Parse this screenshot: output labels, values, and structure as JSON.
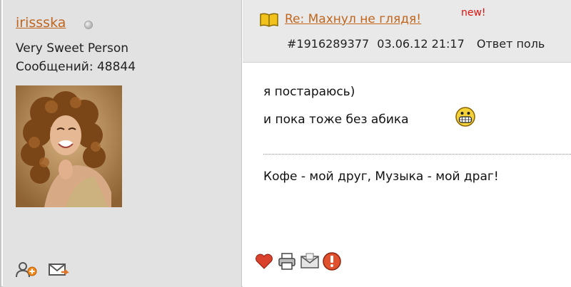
{
  "user": {
    "username": "irissska",
    "title": "Very Sweet Person",
    "posts": "Сообщений: 48844"
  },
  "message": {
    "subject": "Re: Махнул не глядя!",
    "badge": "new!",
    "id": "#1916289377",
    "datetime": "03.06.12 21:17",
    "reply": "Ответ поль",
    "lines": [
      "я постараюсь)",
      "и пока тоже без абика"
    ],
    "signature": "Кофе - мой друг, Музыка - мой драг!"
  },
  "colors": {
    "link": "#c0661f",
    "new_badge": "#dd1111",
    "user_column_bg": "#e2e2e2",
    "header_bg": "#e9e9e9"
  },
  "icons": {
    "status": "offline-status-icon",
    "subject": "book-icon",
    "emoticon": "grinning-smiley-icon",
    "user_actions": [
      "add-friend-icon",
      "private-message-icon"
    ],
    "post_actions": [
      "like-heart-icon",
      "print-icon",
      "email-icon",
      "report-icon"
    ]
  }
}
